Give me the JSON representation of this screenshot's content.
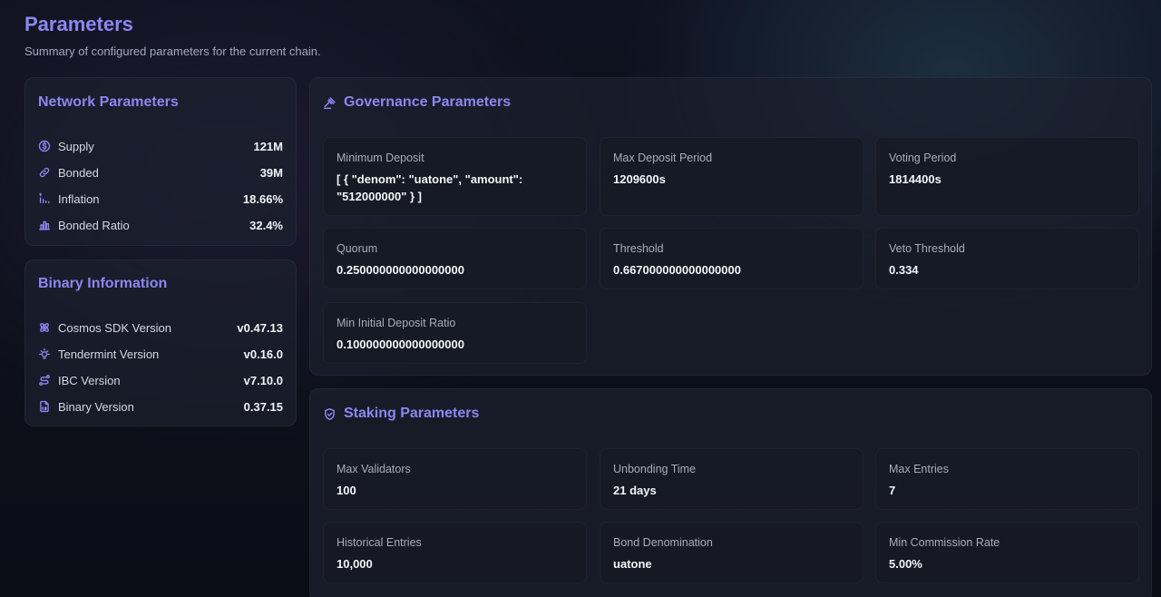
{
  "header": {
    "title": "Parameters",
    "subtitle": "Summary of configured parameters for the current chain."
  },
  "network": {
    "title": "Network Parameters",
    "items": [
      {
        "label": "Supply",
        "value": "121M",
        "icon": "dollar-circle-icon"
      },
      {
        "label": "Bonded",
        "value": "39M",
        "icon": "link-icon"
      },
      {
        "label": "Inflation",
        "value": "18.66%",
        "icon": "signal-bars-icon"
      },
      {
        "label": "Bonded Ratio",
        "value": "32.4%",
        "icon": "bar-chart-icon"
      }
    ]
  },
  "binary": {
    "title": "Binary Information",
    "items": [
      {
        "label": "Cosmos SDK Version",
        "value": "v0.47.13",
        "icon": "atom-icon"
      },
      {
        "label": "Tendermint Version",
        "value": "v0.16.0",
        "icon": "lightbulb-icon"
      },
      {
        "label": "IBC Version",
        "value": "v7.10.0",
        "icon": "route-icon"
      },
      {
        "label": "Binary Version",
        "value": "0.37.15",
        "icon": "file-binary-icon"
      }
    ]
  },
  "governance": {
    "title": "Governance Parameters",
    "icon": "gavel-icon",
    "tiles": [
      {
        "label": "Minimum Deposit",
        "value": "[ { \"denom\": \"uatone\", \"amount\": \"512000000\" } ]"
      },
      {
        "label": "Max Deposit Period",
        "value": "1209600s"
      },
      {
        "label": "Voting Period",
        "value": "1814400s"
      },
      {
        "label": "Quorum",
        "value": "0.250000000000000000"
      },
      {
        "label": "Threshold",
        "value": "0.667000000000000000"
      },
      {
        "label": "Veto Threshold",
        "value": "0.334"
      },
      {
        "label": "Min Initial Deposit Ratio",
        "value": "0.100000000000000000"
      }
    ]
  },
  "staking": {
    "title": "Staking Parameters",
    "icon": "shield-check-icon",
    "tiles": [
      {
        "label": "Max Validators",
        "value": "100"
      },
      {
        "label": "Unbonding Time",
        "value": "21 days"
      },
      {
        "label": "Max Entries",
        "value": "7"
      },
      {
        "label": "Historical Entries",
        "value": "10,000"
      },
      {
        "label": "Bond Denomination",
        "value": "uatone"
      },
      {
        "label": "Min Commission Rate",
        "value": "5.00%"
      }
    ]
  }
}
